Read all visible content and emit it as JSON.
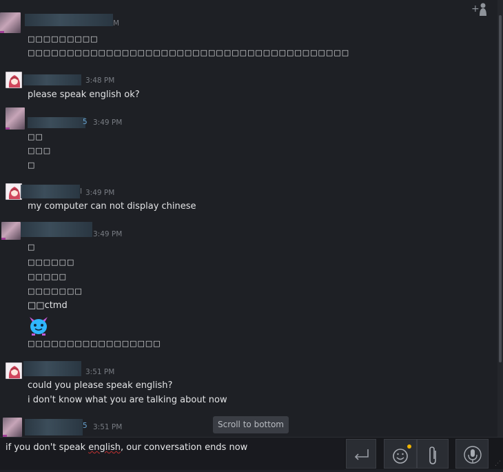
{
  "messages": [
    {
      "avatar": "blurred-user-avatar",
      "time": "M",
      "lines": [
        "□□□□□□□□□",
        "□□□□□□□□□□□□□□□□□□□□□□□□□□□□□□□□□□□□□□□□□"
      ]
    },
    {
      "avatar": "anime-avatar",
      "time": "3:48 PM",
      "lines": [
        "please speak english ok?"
      ]
    },
    {
      "avatar": "blurred-user-avatar",
      "time": "3:49 PM",
      "name_suffix": "5",
      "lines": [
        "□□",
        "□□□",
        "□"
      ]
    },
    {
      "avatar": "anime-avatar",
      "time": "3:49 PM",
      "name_suffix": "I",
      "lines": [
        "my computer can not display chinese"
      ]
    },
    {
      "avatar": "blurred-user-avatar",
      "time": "3:49 PM",
      "lines": [
        "□",
        "□□□□□□",
        "□□□□□",
        "□□□□□□□",
        "□□ctmd",
        "□□□□□□□□□□□□□□□□□"
      ]
    },
    {
      "avatar": "anime-avatar",
      "time": "3:51 PM",
      "lines": [
        "could you please speak english?",
        "i don't know what you are talking about now"
      ]
    },
    {
      "avatar": "blurred-user-avatar",
      "time": "3:51 PM",
      "name_suffix": "5",
      "lines": []
    }
  ],
  "scroll_to_bottom_label": "Scroll to bottom",
  "composer": {
    "text_before": "if you don't speak ",
    "text_misspelled": "english",
    "text_after": ", our conversation ends now"
  },
  "icons": {
    "add_friend": "add-friend-icon",
    "send": "send-return-icon",
    "emoji": "emoji-smiley-icon",
    "attach": "paperclip-icon",
    "voice": "microphone-icon"
  },
  "colors": {
    "background": "#1e2025",
    "timestamp": "#787c83",
    "notification_dot": "#f0b400"
  }
}
